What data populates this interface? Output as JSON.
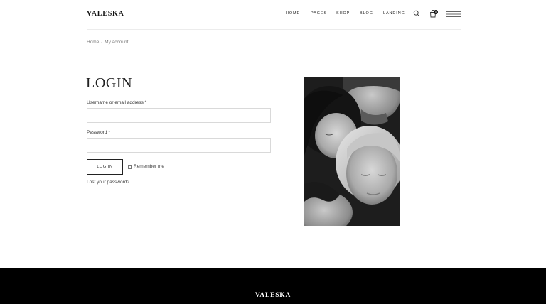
{
  "header": {
    "logo": "VALESKA",
    "nav": {
      "home": "HOME",
      "pages": "PAGES",
      "shop": "SHOP",
      "blog": "BLOG",
      "landing": "LANDING"
    },
    "cart_count": "0",
    "icons": [
      "search-icon",
      "cart-icon",
      "menu-icon"
    ]
  },
  "breadcrumb": {
    "home": "Home",
    "separator": "/",
    "current": "My account"
  },
  "login": {
    "title": "LOGIN",
    "username_label": "Username or email address *",
    "username_value": "",
    "password_label": "Password *",
    "password_value": "",
    "button_label": "LOG IN",
    "remember_label": "Remember me",
    "remember_checked": false,
    "lost_password": "Lost your password?"
  },
  "footer": {
    "logo": "VALESKA"
  },
  "colors": {
    "text": "#222222",
    "muted": "#777777",
    "border": "#d9d9d9",
    "footer_bg": "#000000",
    "footer_text": "#ffffff"
  }
}
